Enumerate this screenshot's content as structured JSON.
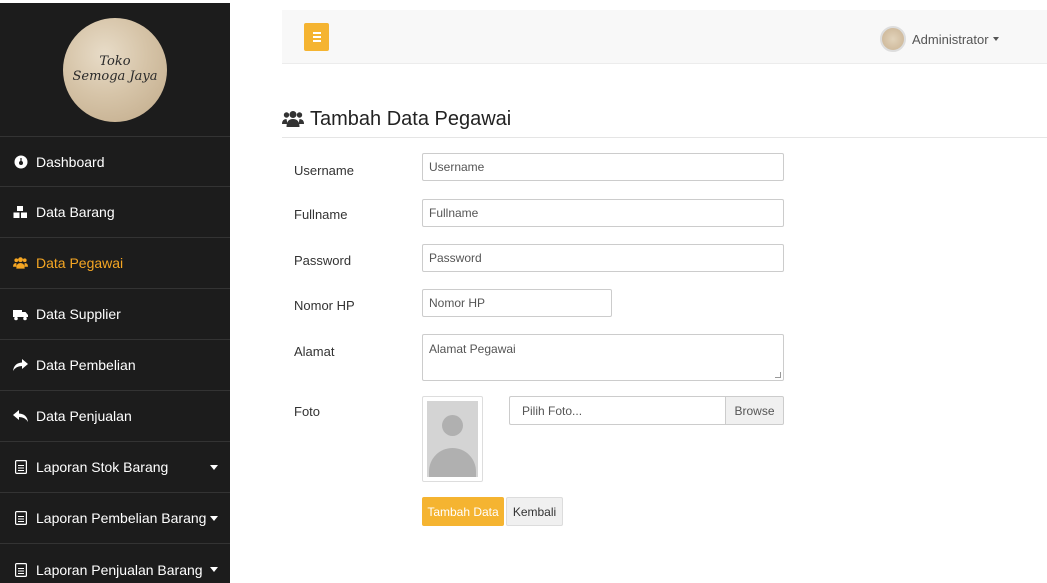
{
  "brand": {
    "logo_line1": "Toko",
    "logo_line2": "Semoga Jaya"
  },
  "sidebar": {
    "items": [
      {
        "label": "Dashboard",
        "icon": "dashboard-icon"
      },
      {
        "label": "Data Barang",
        "icon": "cubes-icon"
      },
      {
        "label": "Data Pegawai",
        "icon": "users-icon",
        "active": true
      },
      {
        "label": "Data Supplier",
        "icon": "truck-icon"
      },
      {
        "label": "Data Pembelian",
        "icon": "share-icon"
      },
      {
        "label": "Data Penjualan",
        "icon": "reply-icon"
      },
      {
        "label": "Laporan Stok Barang",
        "icon": "file-icon",
        "dropdown": true
      },
      {
        "label": "Laporan Pembelian Barang",
        "icon": "file-icon",
        "dropdown": true
      },
      {
        "label": "Laporan Penjualan Barang",
        "icon": "file-icon",
        "dropdown": true
      }
    ]
  },
  "header": {
    "user_name": "Administrator"
  },
  "page": {
    "title": "Tambah Data Pegawai"
  },
  "form": {
    "username": {
      "label": "Username",
      "placeholder": "Username"
    },
    "fullname": {
      "label": "Fullname",
      "placeholder": "Fullname"
    },
    "password": {
      "label": "Password",
      "placeholder": "Password"
    },
    "nomor_hp": {
      "label": "Nomor HP",
      "placeholder": "Nomor HP"
    },
    "alamat": {
      "label": "Alamat",
      "placeholder": "Alamat Pegawai"
    },
    "foto": {
      "label": "Foto",
      "file_placeholder": "Pilih Foto...",
      "browse_label": "Browse"
    },
    "submit_label": "Tambah Data",
    "back_label": "Kembali"
  },
  "colors": {
    "accent": "#f5b431",
    "sidebar_bg": "#1c1c1c",
    "active_text": "#f5a623"
  }
}
